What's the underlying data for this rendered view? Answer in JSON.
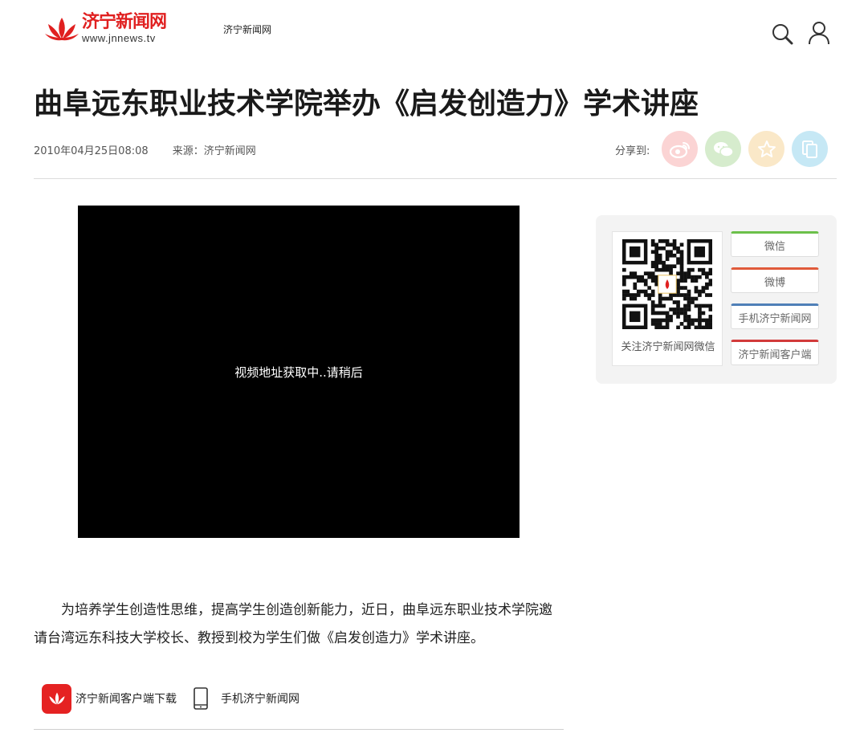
{
  "header": {
    "logo_cn": "济宁新闻网",
    "logo_url": "www.jnnews.tv",
    "site_link": "济宁新闻网"
  },
  "article": {
    "title": "曲阜远东职业技术学院举办《启发创造力》学术讲座",
    "datetime": "2010年04月25日08:08",
    "source": "来源：济宁新闻网",
    "share_label": "分享到:",
    "video_message": "视频地址获取中..请稍后",
    "body": "为培养学生创造性思维，提高学生创造创新能力，近日，曲阜远东职业技术学院邀请台湾远东科技大学校长、教授到校为学生们做《启发创造力》学术讲座。"
  },
  "sidebar": {
    "qr_caption": "关注济宁新闻网微信",
    "buttons": [
      "微信",
      "微博",
      "手机济宁新闻网",
      "济宁新闻客户端"
    ]
  },
  "footer_links": {
    "app_download": "济宁新闻客户端下载",
    "mobile_site": "手机济宁新闻网"
  },
  "colors": {
    "brand_red": "#e02020",
    "weibo_bg": "#fbd4d4",
    "wechat_bg": "#d6eccd",
    "fav_bg": "#fae8c8",
    "copy_bg": "#c6e8f5"
  }
}
